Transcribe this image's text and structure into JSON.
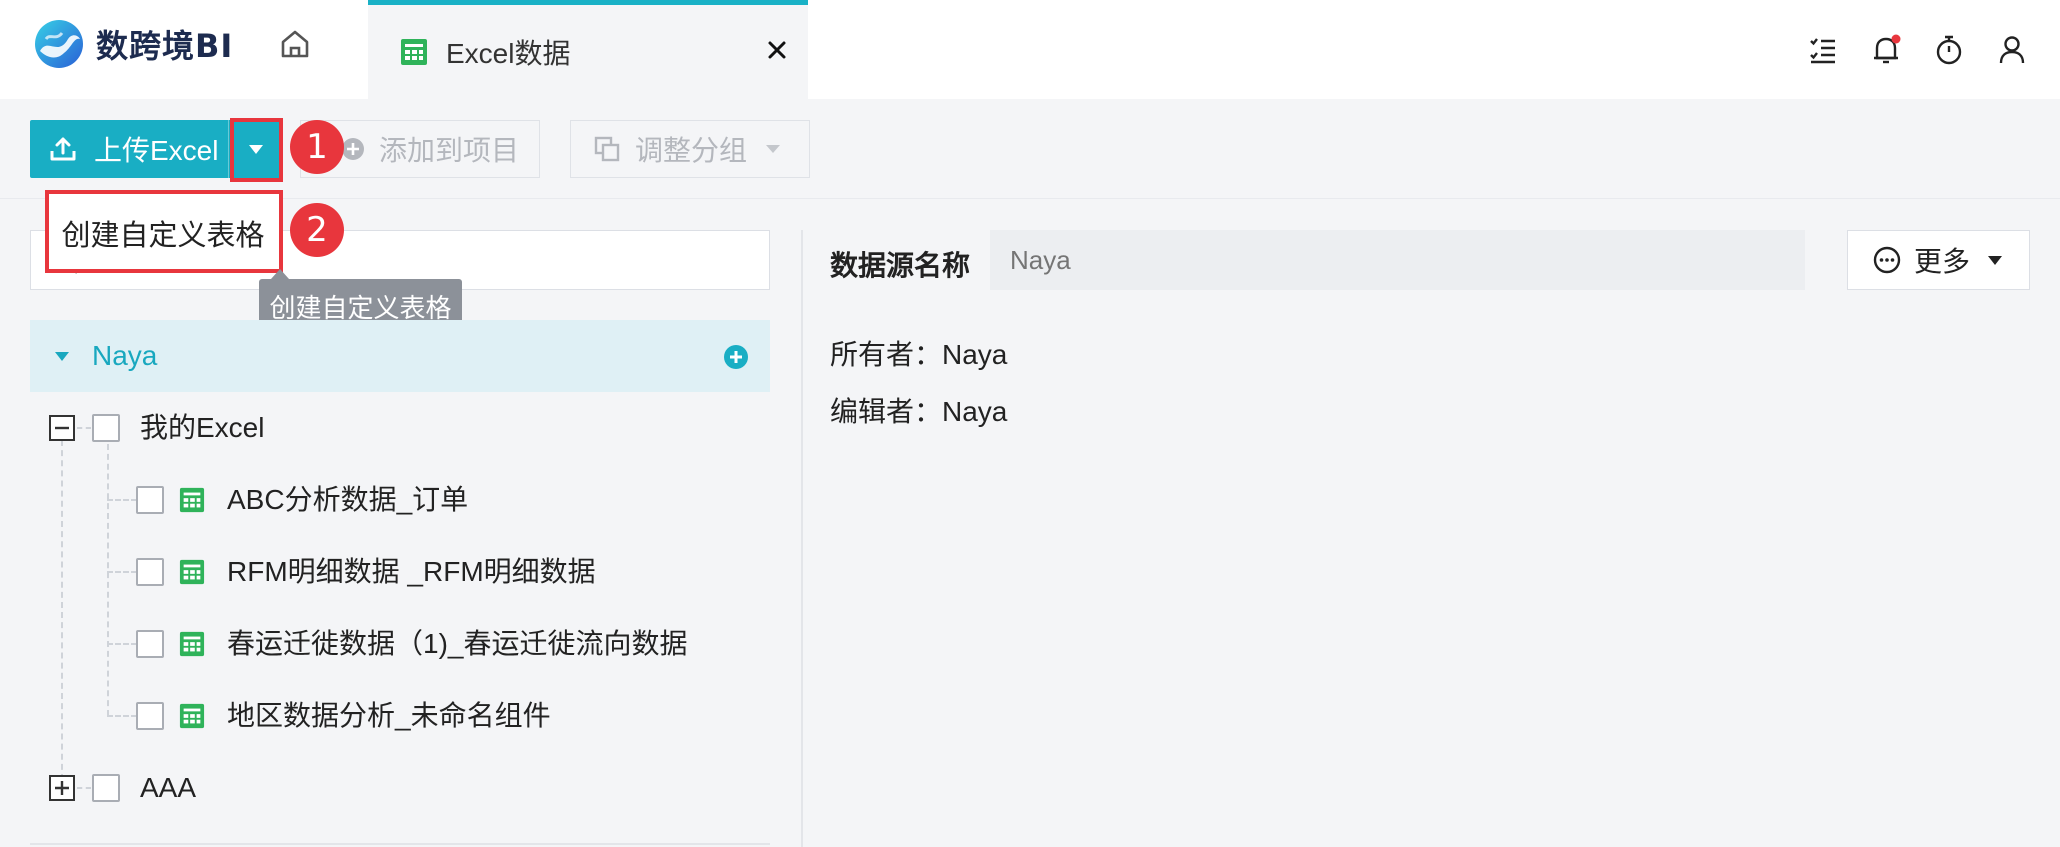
{
  "app": {
    "logo_text": "数跨境BI"
  },
  "tab": {
    "label": "Excel数据"
  },
  "toolbar": {
    "upload_label": "上传Excel",
    "add_to_project_label": "添加到项目",
    "adjust_group_label": "调整分组",
    "dropdown_item": "创建自定义表格",
    "tooltip": "创建自定义表格"
  },
  "callouts": [
    "1",
    "2"
  ],
  "tree": {
    "group_name": "Naya",
    "folders": [
      {
        "name": "我的Excel",
        "expanded": true,
        "items": [
          "ABC分析数据_订单",
          "RFM明细数据 _RFM明细数据",
          "春运迁徙数据（1)_春运迁徙流向数据",
          "地区数据分析_未命名组件"
        ]
      },
      {
        "name": "AAA",
        "expanded": false,
        "items": []
      }
    ]
  },
  "detail": {
    "datasource_label": "数据源名称",
    "datasource_placeholder": "Naya",
    "more_label": "更多",
    "owner_line": "所有者：Naya",
    "editor_line": "编辑者：Naya"
  },
  "colors": {
    "accent": "#19aec4",
    "callout": "#e8363d",
    "group_bg": "#dff0f5",
    "sheet_green": "#2fb35a"
  }
}
